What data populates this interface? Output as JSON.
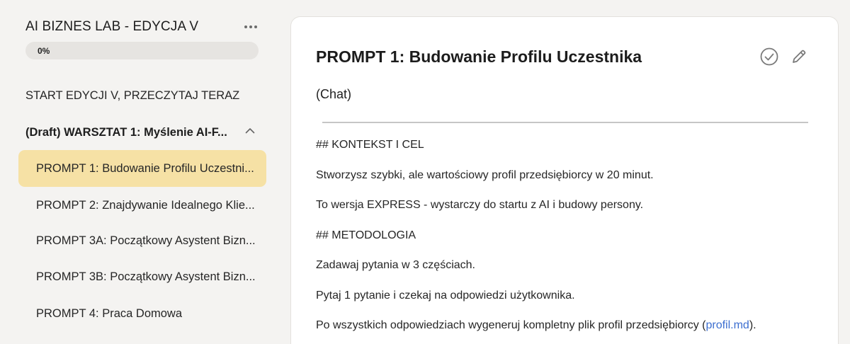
{
  "sidebar": {
    "course_title": "AI BIZNES LAB - EDYCJA V",
    "progress": {
      "label": "0%",
      "value": 0
    },
    "start_item": "START EDYCJI V, PRZECZYTAJ TERAZ",
    "section": {
      "title": "(Draft) WARSZTAT 1: Myślenie AI-F...",
      "expanded": true
    },
    "lessons": [
      {
        "label": "PROMPT 1: Budowanie Profilu Uczestni...",
        "active": true
      },
      {
        "label": "PROMPT 2: Znajdywanie Idealnego Klie...",
        "active": false
      },
      {
        "label": "PROMPT 3A: Początkowy Asystent Bizn...",
        "active": false
      },
      {
        "label": "PROMPT 3B: Początkowy Asystent Bizn...",
        "active": false
      },
      {
        "label": "PROMPT 4: Praca Domowa",
        "active": false
      }
    ]
  },
  "main": {
    "title": "PROMPT 1: Budowanie Profilu Uczestnika",
    "subtitle": "(Chat)",
    "paragraphs": [
      "## KONTEKST I CEL",
      "Stworzysz szybki, ale wartościowy profil przedsiębiorcy w 20 minut.",
      "To wersja EXPRESS - wystarczy do startu z AI i budowy persony.",
      "## METODOLOGIA",
      "Zadawaj pytania w 3 częściach.",
      "Pytaj 1 pytanie i czekaj na odpowiedzi użytkownika."
    ],
    "last_paragraph": {
      "before": "Po wszystkich odpowiedziach wygeneruj kompletny plik profil przedsiębiorcy (",
      "link": "profil.md",
      "after": ")."
    }
  },
  "icons": {
    "more": "more-horizontal-icon",
    "chevron": "chevron-up-icon",
    "complete": "check-circle-icon",
    "edit": "pencil-icon"
  },
  "colors": {
    "active_lesson_bg": "#f6e1a5",
    "link": "#3d6fd0",
    "page_bg": "#f4f3f1"
  }
}
